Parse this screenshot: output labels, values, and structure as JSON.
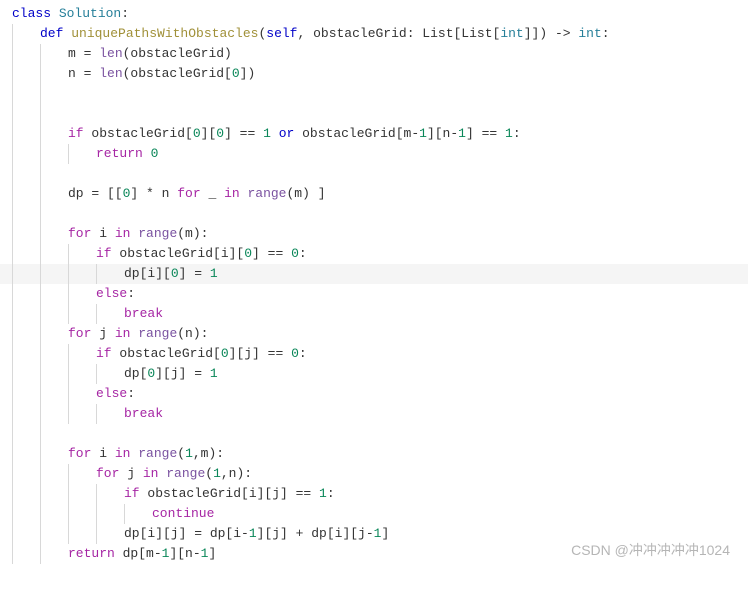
{
  "code": {
    "lines": [
      {
        "indent": 0,
        "highlighted": false,
        "tokens": [
          {
            "t": "class ",
            "c": "kw"
          },
          {
            "t": "Solution",
            "c": "cls"
          },
          {
            "t": ":",
            "c": "op"
          }
        ]
      },
      {
        "indent": 1,
        "highlighted": false,
        "tokens": [
          {
            "t": "def ",
            "c": "kw"
          },
          {
            "t": "uniquePathsWithObstacles",
            "c": "fn"
          },
          {
            "t": "(",
            "c": "op"
          },
          {
            "t": "self",
            "c": "kw"
          },
          {
            "t": ", obstacleGrid: List[List[",
            "c": "id"
          },
          {
            "t": "int",
            "c": "cls"
          },
          {
            "t": "]]) -> ",
            "c": "id"
          },
          {
            "t": "int",
            "c": "cls"
          },
          {
            "t": ":",
            "c": "op"
          }
        ]
      },
      {
        "indent": 2,
        "highlighted": false,
        "tokens": [
          {
            "t": "m = ",
            "c": "id"
          },
          {
            "t": "len",
            "c": "def"
          },
          {
            "t": "(obstacleGrid)",
            "c": "id"
          }
        ]
      },
      {
        "indent": 2,
        "highlighted": false,
        "tokens": [
          {
            "t": "n = ",
            "c": "id"
          },
          {
            "t": "len",
            "c": "def"
          },
          {
            "t": "(obstacleGrid[",
            "c": "id"
          },
          {
            "t": "0",
            "c": "num"
          },
          {
            "t": "])",
            "c": "id"
          }
        ]
      },
      {
        "indent": 2,
        "highlighted": false,
        "tokens": []
      },
      {
        "indent": 2,
        "highlighted": false,
        "tokens": []
      },
      {
        "indent": 2,
        "highlighted": false,
        "tokens": [
          {
            "t": "if ",
            "c": "kw2"
          },
          {
            "t": "obstacleGrid[",
            "c": "id"
          },
          {
            "t": "0",
            "c": "num"
          },
          {
            "t": "][",
            "c": "id"
          },
          {
            "t": "0",
            "c": "num"
          },
          {
            "t": "] == ",
            "c": "id"
          },
          {
            "t": "1",
            "c": "num"
          },
          {
            "t": " or ",
            "c": "kw"
          },
          {
            "t": "obstacleGrid[m-",
            "c": "id"
          },
          {
            "t": "1",
            "c": "num"
          },
          {
            "t": "][n-",
            "c": "id"
          },
          {
            "t": "1",
            "c": "num"
          },
          {
            "t": "] == ",
            "c": "id"
          },
          {
            "t": "1",
            "c": "num"
          },
          {
            "t": ":",
            "c": "op"
          }
        ]
      },
      {
        "indent": 3,
        "highlighted": false,
        "tokens": [
          {
            "t": "return ",
            "c": "kw2"
          },
          {
            "t": "0",
            "c": "num"
          }
        ]
      },
      {
        "indent": 2,
        "highlighted": false,
        "tokens": []
      },
      {
        "indent": 2,
        "highlighted": false,
        "tokens": [
          {
            "t": "dp = [[",
            "c": "id"
          },
          {
            "t": "0",
            "c": "num"
          },
          {
            "t": "] * n ",
            "c": "id"
          },
          {
            "t": "for ",
            "c": "kw2"
          },
          {
            "t": "_ ",
            "c": "id"
          },
          {
            "t": "in ",
            "c": "kw2"
          },
          {
            "t": "range",
            "c": "def"
          },
          {
            "t": "(m) ]",
            "c": "id"
          }
        ]
      },
      {
        "indent": 2,
        "highlighted": false,
        "tokens": []
      },
      {
        "indent": 2,
        "highlighted": false,
        "tokens": [
          {
            "t": "for ",
            "c": "kw2"
          },
          {
            "t": "i ",
            "c": "id"
          },
          {
            "t": "in ",
            "c": "kw2"
          },
          {
            "t": "range",
            "c": "def"
          },
          {
            "t": "(m):",
            "c": "id"
          }
        ]
      },
      {
        "indent": 3,
        "highlighted": false,
        "tokens": [
          {
            "t": "if ",
            "c": "kw2"
          },
          {
            "t": "obstacleGrid[i][",
            "c": "id"
          },
          {
            "t": "0",
            "c": "num"
          },
          {
            "t": "] == ",
            "c": "id"
          },
          {
            "t": "0",
            "c": "num"
          },
          {
            "t": ":",
            "c": "op"
          }
        ]
      },
      {
        "indent": 4,
        "highlighted": true,
        "tokens": [
          {
            "t": "dp[i][",
            "c": "id"
          },
          {
            "t": "0",
            "c": "num"
          },
          {
            "t": "] = ",
            "c": "id"
          },
          {
            "t": "1",
            "c": "num"
          }
        ]
      },
      {
        "indent": 3,
        "highlighted": false,
        "tokens": [
          {
            "t": "else",
            "c": "kw2"
          },
          {
            "t": ":",
            "c": "op"
          }
        ]
      },
      {
        "indent": 4,
        "highlighted": false,
        "tokens": [
          {
            "t": "break",
            "c": "kw2"
          }
        ]
      },
      {
        "indent": 2,
        "highlighted": false,
        "tokens": [
          {
            "t": "for ",
            "c": "kw2"
          },
          {
            "t": "j ",
            "c": "id"
          },
          {
            "t": "in ",
            "c": "kw2"
          },
          {
            "t": "range",
            "c": "def"
          },
          {
            "t": "(n):",
            "c": "id"
          }
        ]
      },
      {
        "indent": 3,
        "highlighted": false,
        "tokens": [
          {
            "t": "if ",
            "c": "kw2"
          },
          {
            "t": "obstacleGrid[",
            "c": "id"
          },
          {
            "t": "0",
            "c": "num"
          },
          {
            "t": "][j] == ",
            "c": "id"
          },
          {
            "t": "0",
            "c": "num"
          },
          {
            "t": ":",
            "c": "op"
          }
        ]
      },
      {
        "indent": 4,
        "highlighted": false,
        "tokens": [
          {
            "t": "dp[",
            "c": "id"
          },
          {
            "t": "0",
            "c": "num"
          },
          {
            "t": "][j] = ",
            "c": "id"
          },
          {
            "t": "1",
            "c": "num"
          }
        ]
      },
      {
        "indent": 3,
        "highlighted": false,
        "tokens": [
          {
            "t": "else",
            "c": "kw2"
          },
          {
            "t": ":",
            "c": "op"
          }
        ]
      },
      {
        "indent": 4,
        "highlighted": false,
        "tokens": [
          {
            "t": "break",
            "c": "kw2"
          }
        ]
      },
      {
        "indent": 2,
        "highlighted": false,
        "tokens": []
      },
      {
        "indent": 2,
        "highlighted": false,
        "tokens": [
          {
            "t": "for ",
            "c": "kw2"
          },
          {
            "t": "i ",
            "c": "id"
          },
          {
            "t": "in ",
            "c": "kw2"
          },
          {
            "t": "range",
            "c": "def"
          },
          {
            "t": "(",
            "c": "id"
          },
          {
            "t": "1",
            "c": "num"
          },
          {
            "t": ",m):",
            "c": "id"
          }
        ]
      },
      {
        "indent": 3,
        "highlighted": false,
        "tokens": [
          {
            "t": "for ",
            "c": "kw2"
          },
          {
            "t": "j ",
            "c": "id"
          },
          {
            "t": "in ",
            "c": "kw2"
          },
          {
            "t": "range",
            "c": "def"
          },
          {
            "t": "(",
            "c": "id"
          },
          {
            "t": "1",
            "c": "num"
          },
          {
            "t": ",n):",
            "c": "id"
          }
        ]
      },
      {
        "indent": 4,
        "highlighted": false,
        "tokens": [
          {
            "t": "if ",
            "c": "kw2"
          },
          {
            "t": "obstacleGrid[i][j] == ",
            "c": "id"
          },
          {
            "t": "1",
            "c": "num"
          },
          {
            "t": ":",
            "c": "op"
          }
        ]
      },
      {
        "indent": 5,
        "highlighted": false,
        "tokens": [
          {
            "t": "continue",
            "c": "kw2"
          }
        ]
      },
      {
        "indent": 4,
        "highlighted": false,
        "tokens": [
          {
            "t": "dp[i][j] = dp[i-",
            "c": "id"
          },
          {
            "t": "1",
            "c": "num"
          },
          {
            "t": "][j] + dp[i][j-",
            "c": "id"
          },
          {
            "t": "1",
            "c": "num"
          },
          {
            "t": "]",
            "c": "id"
          }
        ]
      },
      {
        "indent": 2,
        "highlighted": false,
        "tokens": [
          {
            "t": "return ",
            "c": "kw2"
          },
          {
            "t": "dp[m-",
            "c": "id"
          },
          {
            "t": "1",
            "c": "num"
          },
          {
            "t": "][n-",
            "c": "id"
          },
          {
            "t": "1",
            "c": "num"
          },
          {
            "t": "]",
            "c": "id"
          }
        ]
      }
    ]
  },
  "watermark": "CSDN @冲冲冲冲冲1024"
}
